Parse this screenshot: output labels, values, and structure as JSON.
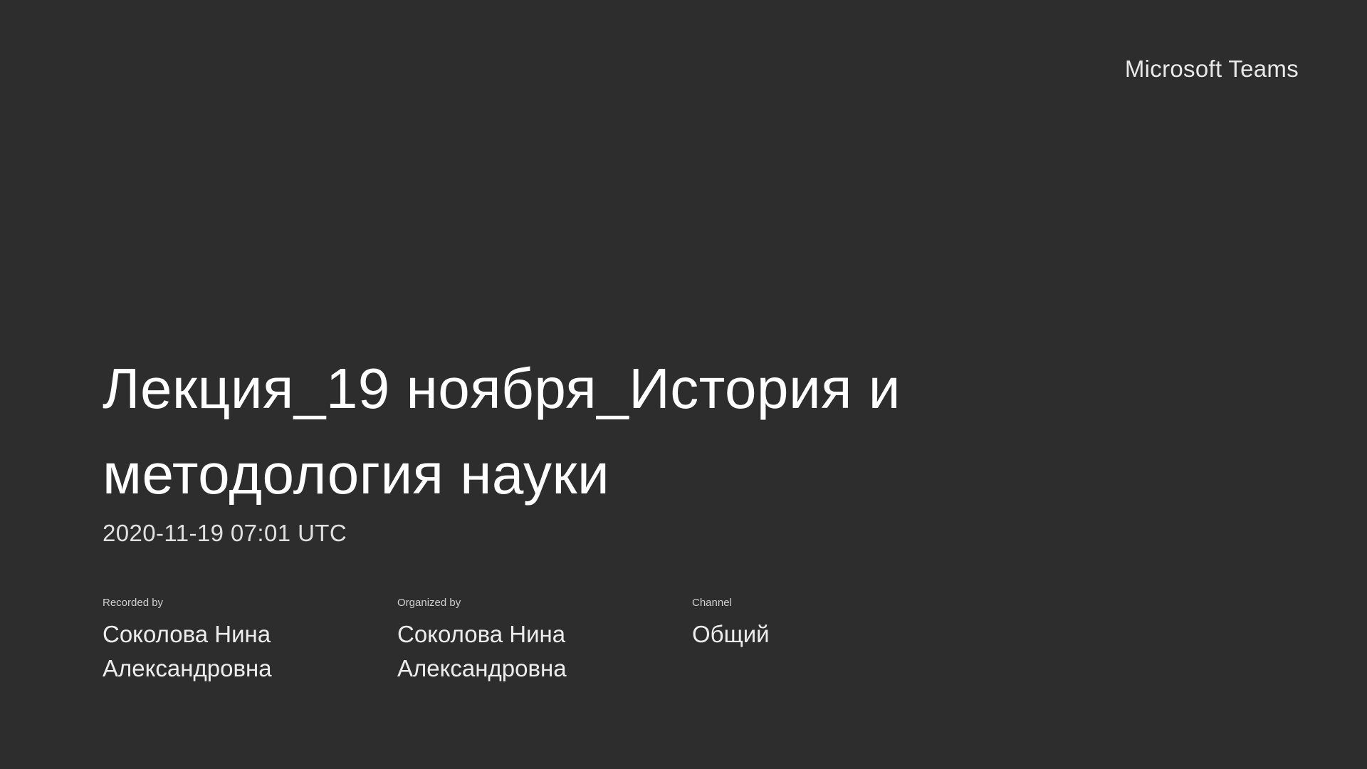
{
  "header": {
    "brand": "Microsoft Teams"
  },
  "recording": {
    "title": "Лекция_19 ноября_История и методология науки",
    "datetime": "2020-11-19 07:01 UTC"
  },
  "meta": [
    {
      "label": "Recorded by",
      "value": "Соколова Нина Александровна"
    },
    {
      "label": "Organized by",
      "value": "Соколова Нина Александровна"
    },
    {
      "label": "Channel",
      "value": "Общий"
    }
  ],
  "colors": {
    "background": "#2d2d2d",
    "text": "#ffffff"
  }
}
